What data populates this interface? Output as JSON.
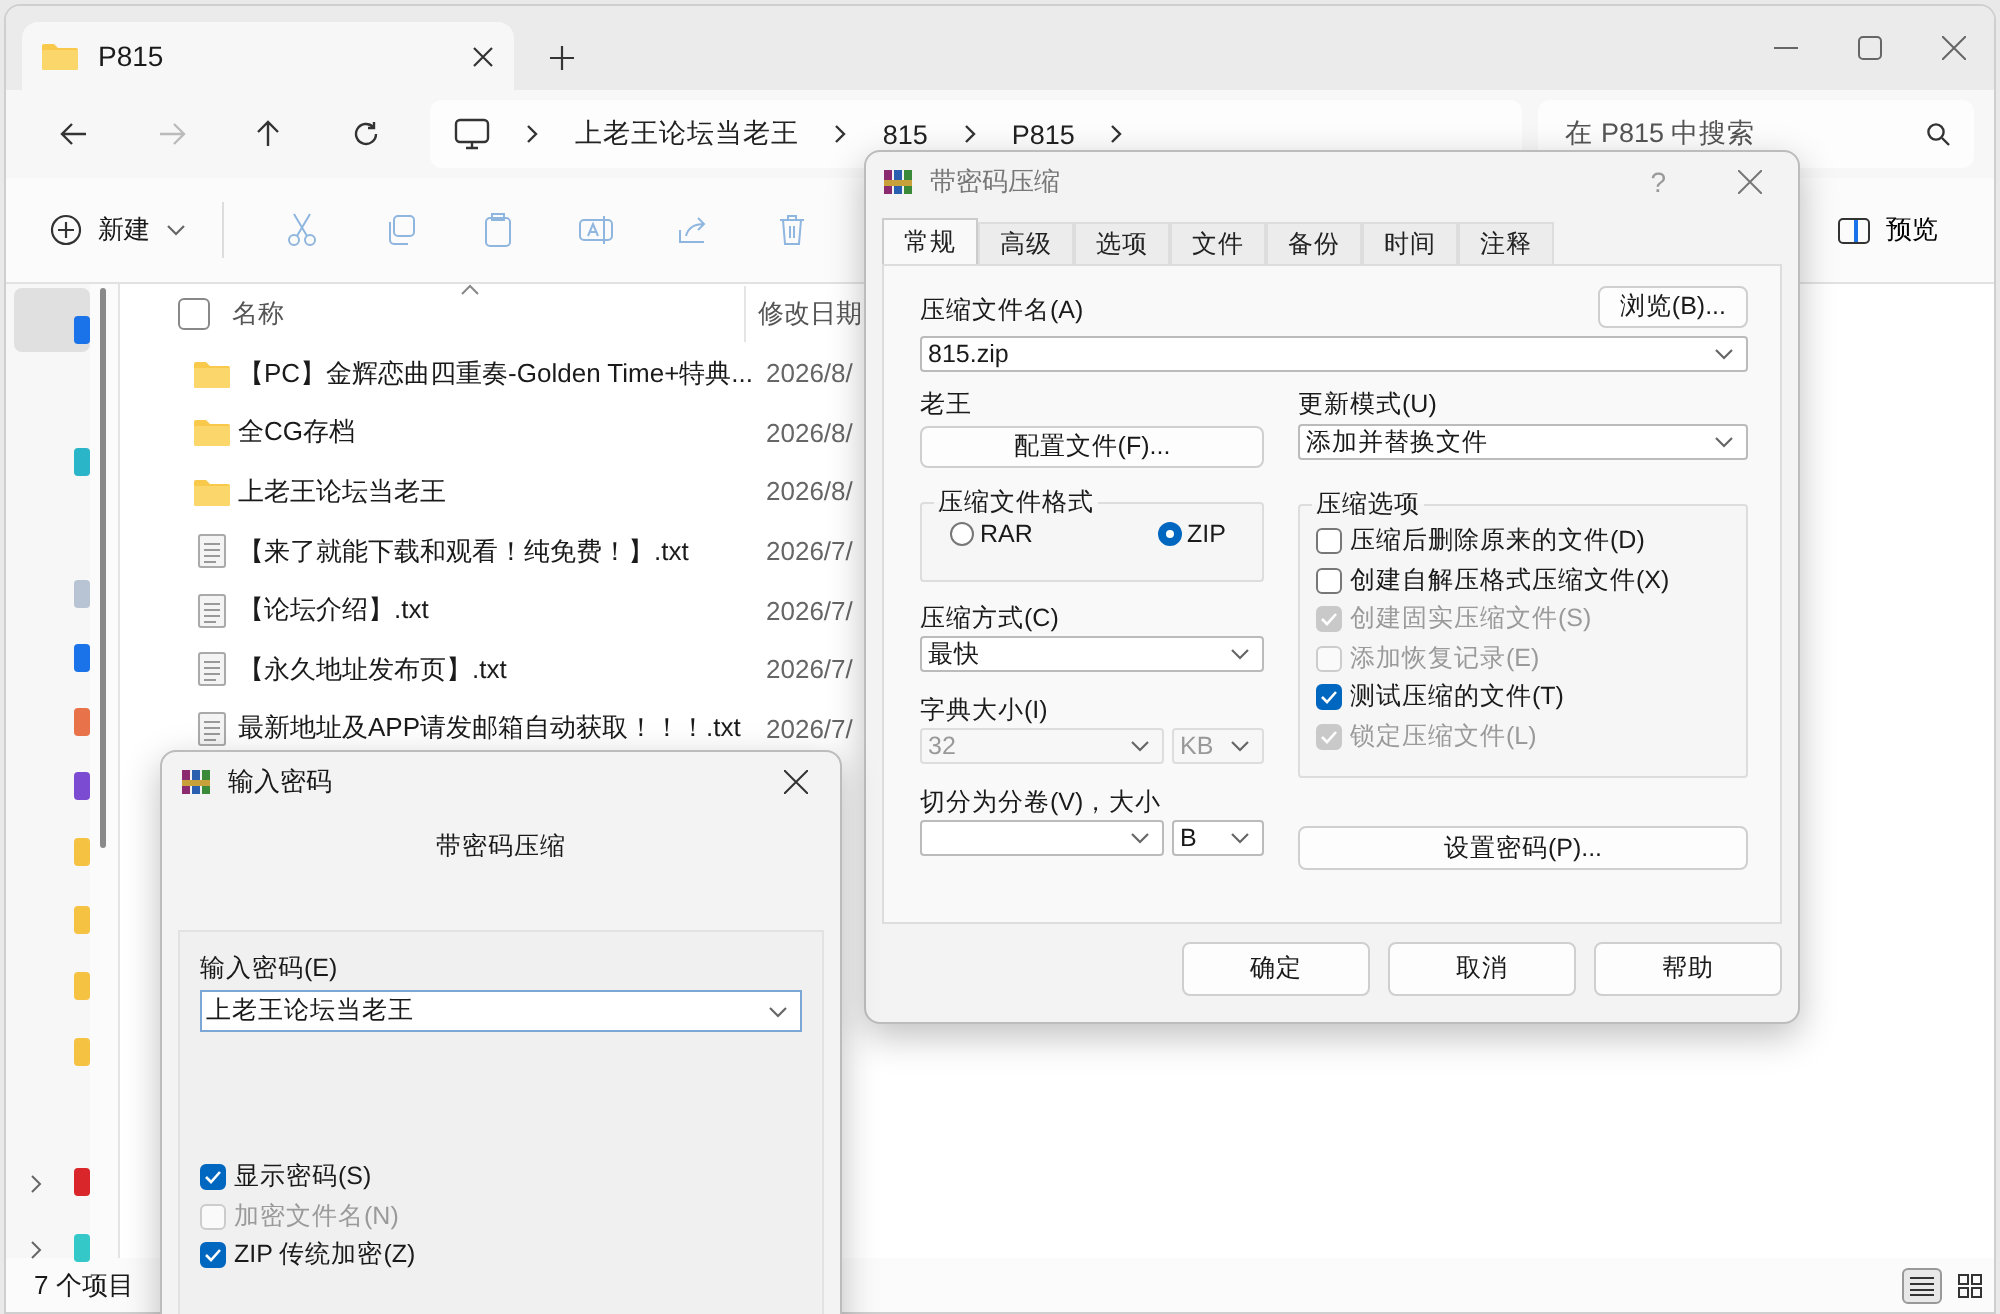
{
  "explorer": {
    "tab": {
      "title": "P815"
    },
    "breadcrumbs": [
      "上老王论坛当老王",
      "815",
      "P815"
    ],
    "search": {
      "placeholder": "在 P815 中搜索"
    },
    "toolbar": {
      "new": "新建",
      "preview": "预览"
    },
    "select_all": {
      "checked": false
    },
    "columns": [
      "名称",
      "修改日期"
    ],
    "files": [
      {
        "kind": "folder",
        "name": "【PC】金辉恋曲四重奏-Golden Time+特典...",
        "date": "2026/8/"
      },
      {
        "kind": "folder",
        "name": "全CG存档",
        "date": "2026/8/"
      },
      {
        "kind": "folder",
        "name": "上老王论坛当老王",
        "date": "2026/8/"
      },
      {
        "kind": "text",
        "name": "【来了就能下载和观看！纯免费！】.txt",
        "date": "2026/7/"
      },
      {
        "kind": "text",
        "name": "【论坛介绍】.txt",
        "date": "2026/7/"
      },
      {
        "kind": "text",
        "name": "【永久地址发布页】.txt",
        "date": "2026/7/"
      },
      {
        "kind": "text",
        "name": "最新地址及APP请发邮箱自动获取！！！.txt",
        "date": "2026/7/"
      }
    ],
    "status": "7 个项目"
  },
  "archive_dialog": {
    "title": "带密码压缩",
    "help": "?",
    "tabs": [
      {
        "label": "常规",
        "selected": true
      },
      {
        "label": "高级",
        "selected": false
      },
      {
        "label": "选项",
        "selected": false
      },
      {
        "label": "文件",
        "selected": false
      },
      {
        "label": "备份",
        "selected": false
      },
      {
        "label": "时间",
        "selected": false
      },
      {
        "label": "注释",
        "selected": false
      }
    ],
    "archive_name_label": "压缩文件名(A)",
    "browse": "浏览(B)...",
    "archive_name": "815.zip",
    "profile_label": "老王",
    "profile_button": "配置文件(F)...",
    "update_mode_label": "更新模式(U)",
    "update_mode": "添加并替换文件",
    "format": {
      "title": "压缩文件格式",
      "options": [
        {
          "label": "RAR",
          "selected": false
        },
        {
          "label": "ZIP",
          "selected": true
        }
      ]
    },
    "options": {
      "title": "压缩选项",
      "items": [
        {
          "label": "压缩后删除原来的文件(D)",
          "checked": false,
          "disabled": false
        },
        {
          "label": "创建自解压格式压缩文件(X)",
          "checked": false,
          "disabled": false
        },
        {
          "label": "创建固实压缩文件(S)",
          "checked": true,
          "disabled": true
        },
        {
          "label": "添加恢复记录(E)",
          "checked": false,
          "disabled": true
        },
        {
          "label": "测试压缩的文件(T)",
          "checked": true,
          "disabled": false
        },
        {
          "label": "锁定压缩文件(L)",
          "checked": true,
          "disabled": true
        }
      ]
    },
    "method_label": "压缩方式(C)",
    "method": "最快",
    "dict_label": "字典大小(I)",
    "dict_size": {
      "value": "32",
      "unit": "KB",
      "disabled": true
    },
    "split_label": "切分为分卷(V)，大小",
    "split_unit": "B",
    "set_password": "设置密码(P)...",
    "buttons": [
      "确定",
      "取消",
      "帮助"
    ]
  },
  "password_dialog": {
    "title": "输入密码",
    "subtitle": "带密码压缩",
    "label": "输入密码(E)",
    "value": "上老王论坛当老王",
    "options": [
      {
        "label": "显示密码(S)",
        "checked": true,
        "disabled": false
      },
      {
        "label": "加密文件名(N)",
        "checked": false,
        "disabled": true
      },
      {
        "label": "ZIP 传统加密(Z)",
        "checked": true,
        "disabled": false
      }
    ]
  }
}
